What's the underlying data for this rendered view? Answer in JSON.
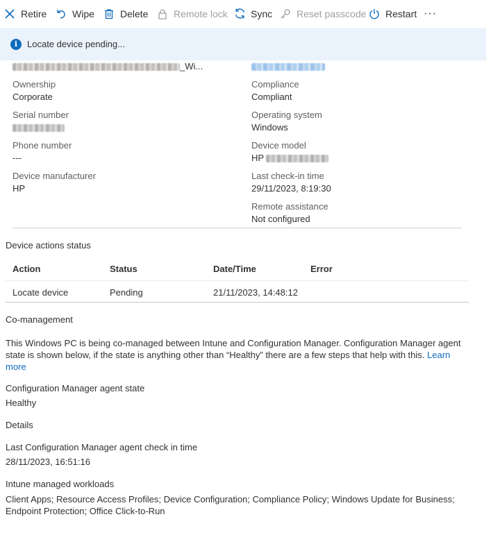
{
  "toolbar": {
    "retire": "Retire",
    "wipe": "Wipe",
    "delete": "Delete",
    "remote_lock": "Remote lock",
    "sync": "Sync",
    "reset_passcode": "Reset passcode",
    "restart": "Restart",
    "more": "···"
  },
  "banner": {
    "message": "Locate device pending..."
  },
  "device": {
    "name_suffix": "_Wi...",
    "ownership": {
      "label": "Ownership",
      "value": "Corporate"
    },
    "serial": {
      "label": "Serial number"
    },
    "phone": {
      "label": "Phone number",
      "value": "---"
    },
    "manufacturer": {
      "label": "Device manufacturer",
      "value": "HP"
    },
    "compliance": {
      "label": "Compliance",
      "value": "Compliant"
    },
    "os": {
      "label": "Operating system",
      "value": "Windows"
    },
    "model": {
      "label": "Device model",
      "value_prefix": "HP "
    },
    "last_checkin": {
      "label": "Last check-in time",
      "value": "29/11/2023, 8:19:30"
    },
    "remote_assistance": {
      "label": "Remote assistance",
      "value": "Not configured"
    }
  },
  "actions_status": {
    "title": "Device actions status",
    "columns": [
      "Action",
      "Status",
      "Date/Time",
      "Error"
    ],
    "rows": [
      {
        "action": "Locate device",
        "status": "Pending",
        "datetime": "21/11/2023, 14:48:12",
        "error": ""
      }
    ]
  },
  "comanagement": {
    "title": "Co-management",
    "description": "This Windows PC is being co-managed between Intune and Configuration Manager. Configuration Manager agent state is shown below, if the state is anything other than “Healthy” there are a few steps that help with this.",
    "learn_more_1": "Learn",
    "learn_more_2": "more",
    "agent_state_label": "Configuration Manager agent state",
    "agent_state_value": "Healthy",
    "details_label": "Details",
    "last_checkin_label": "Last Configuration Manager agent check in time",
    "last_checkin_value": "28/11/2023, 16:51:16",
    "workloads_label": "Intune managed workloads",
    "workloads_value": "Client Apps; Resource Access Profiles; Device Configuration; Compliance Policy; Windows Update for Business; Endpoint Protection; Office Click-to-Run"
  },
  "colors": {
    "accent": "#0f6cbd",
    "banner_bg": "#eaf2fb",
    "disabled_text": "#a19f9d"
  }
}
